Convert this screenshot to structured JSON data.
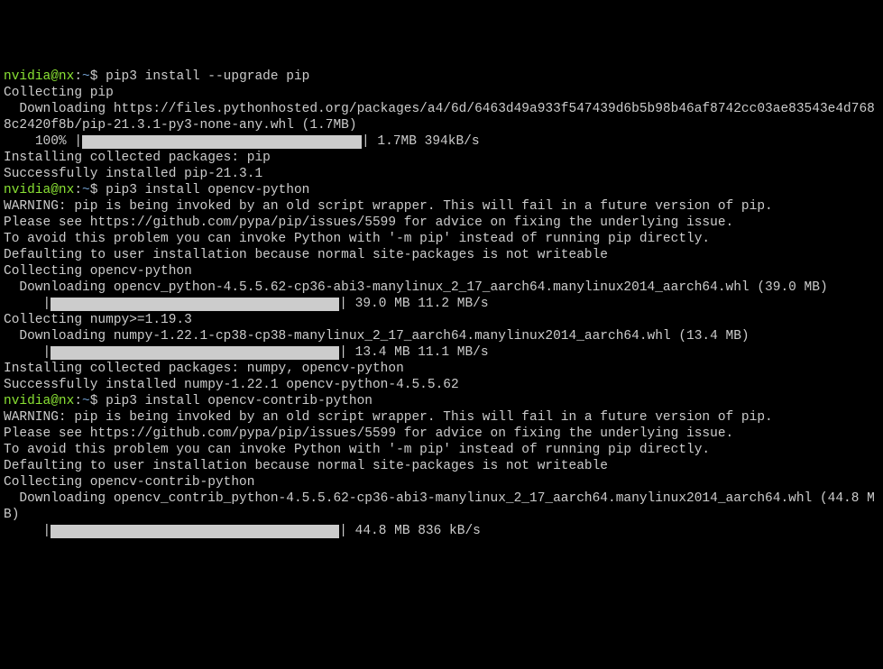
{
  "top_red_line": "",
  "prompt1": {
    "userhost": "nvidia@nx",
    "sep": ":",
    "path": "~",
    "dollar": "$ ",
    "cmd": "pip3 install --upgrade pip"
  },
  "block1": {
    "l1": "Collecting pip",
    "l2": "  Downloading https://files.pythonhosted.org/packages/a4/6d/6463d49a933f547439d6b5b98b46af8742cc03ae83543e4d7688c2420f8b/pip-21.3.1-py3-none-any.whl (1.7MB)",
    "progress_left": "    100% |",
    "progress_right": "| 1.7MB 394kB/s",
    "l4": "Installing collected packages: pip",
    "l5": "Successfully installed pip-21.3.1"
  },
  "prompt2": {
    "userhost": "nvidia@nx",
    "sep": ":",
    "path": "~",
    "dollar": "$ ",
    "cmd": "pip3 install opencv-python"
  },
  "block2": {
    "l1": "WARNING: pip is being invoked by an old script wrapper. This will fail in a future version of pip.",
    "l2": "Please see https://github.com/pypa/pip/issues/5599 for advice on fixing the underlying issue.",
    "l3": "To avoid this problem you can invoke Python with '-m pip' instead of running pip directly.",
    "l4": "Defaulting to user installation because normal site-packages is not writeable",
    "l5": "Collecting opencv-python",
    "l6": "  Downloading opencv_python-4.5.5.62-cp36-abi3-manylinux_2_17_aarch64.manylinux2014_aarch64.whl (39.0 MB)",
    "p1_left": "     |",
    "p1_right": "| 39.0 MB 11.2 MB/s",
    "l7": "Collecting numpy>=1.19.3",
    "l8": "  Downloading numpy-1.22.1-cp38-cp38-manylinux_2_17_aarch64.manylinux2014_aarch64.whl (13.4 MB)",
    "p2_left": "     |",
    "p2_right": "| 13.4 MB 11.1 MB/s",
    "l9": "Installing collected packages: numpy, opencv-python",
    "l10": "Successfully installed numpy-1.22.1 opencv-python-4.5.5.62"
  },
  "prompt3": {
    "userhost": "nvidia@nx",
    "sep": ":",
    "path": "~",
    "dollar": "$ ",
    "cmd": "pip3 install opencv-contrib-python"
  },
  "block3": {
    "l1": "WARNING: pip is being invoked by an old script wrapper. This will fail in a future version of pip.",
    "l2": "Please see https://github.com/pypa/pip/issues/5599 for advice on fixing the underlying issue.",
    "l3": "To avoid this problem you can invoke Python with '-m pip' instead of running pip directly.",
    "l4": "Defaulting to user installation because normal site-packages is not writeable",
    "l5": "Collecting opencv-contrib-python",
    "l6": "  Downloading opencv_contrib_python-4.5.5.62-cp36-abi3-manylinux_2_17_aarch64.manylinux2014_aarch64.whl (44.8 MB)",
    "p1_left": "     |",
    "p1_right": "| 44.8 MB 836 kB/s"
  }
}
